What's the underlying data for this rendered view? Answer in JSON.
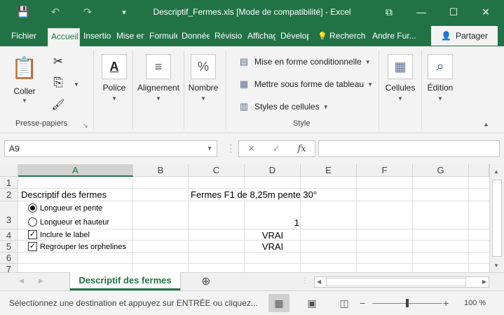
{
  "window": {
    "title": "Descriptif_Fermes.xls  [Mode de compatibilité] - Excel",
    "save_icon": "💾",
    "undo_icon": "↶",
    "redo_icon": "↷",
    "customize_icon": "▾",
    "ribbon_display_icon": "⧉",
    "minimize_icon": "—",
    "restore_icon": "☐",
    "close_icon": "✕"
  },
  "ribbon_tabs": [
    "Fichier",
    "Accueil",
    "Insertion",
    "Mise en page",
    "Formules",
    "Données",
    "Révision",
    "Affichage",
    "Développeur"
  ],
  "search": {
    "icon": "💡",
    "label": "Recherch"
  },
  "user": "Andre Fur...",
  "share": {
    "icon": "👤",
    "label": "Partager"
  },
  "clipboard": {
    "paste_label": "Coller",
    "paste_icon": "📋",
    "cut_icon": "✂",
    "copy_icon": "⎘",
    "format_painter_icon": "🖌",
    "group_label": "Presse-papiers",
    "launcher_icon": "↘"
  },
  "font_group": {
    "label": "Police",
    "icon": "A"
  },
  "alignment_group": {
    "label": "Alignement",
    "icon": "≡"
  },
  "number_group": {
    "label": "Nombre",
    "icon": "%"
  },
  "styles": {
    "conditional_formatting": "Mise en forme conditionnelle",
    "format_as_table": "Mettre sous forme de tableau",
    "cell_styles": "Styles de cellules",
    "group_label": "Style"
  },
  "cells_group": {
    "label": "Cellules",
    "icon": "▦"
  },
  "editing_group": {
    "label": "Édition",
    "icon": "⌕"
  },
  "collapse_icon": "▲",
  "formula_bar": {
    "name_box": "A9",
    "cancel_icon": "✕",
    "enter_icon": "✓",
    "fx_icon": "fx",
    "formula": ""
  },
  "columns": [
    "A",
    "B",
    "C",
    "D",
    "E",
    "F",
    "G"
  ],
  "rows": [
    "1",
    "2",
    "3",
    "4",
    "5",
    "6",
    "7"
  ],
  "cells": {
    "A2": "Descriptif des fermes",
    "C2": "Fermes F1 de 8,25m pente 30°",
    "D3": "1",
    "D4": "VRAI",
    "D5": "VRAI"
  },
  "controls": {
    "radio1": {
      "label": "Longueur et pente",
      "checked": true
    },
    "radio2": {
      "label": "Longueur et hauteur",
      "checked": false
    },
    "check1": {
      "label": "Inclure le label",
      "checked": true
    },
    "check2": {
      "label": "Regrouper les orphelines",
      "checked": true
    }
  },
  "sheet_tab": "Descriptif des fermes",
  "add_sheet_icon": "⊕",
  "status": {
    "message": "Sélectionnez une destination et appuyez sur ENTRÉE ou cliquez...",
    "zoom": "100 %",
    "zoom_level_percent": 100
  }
}
